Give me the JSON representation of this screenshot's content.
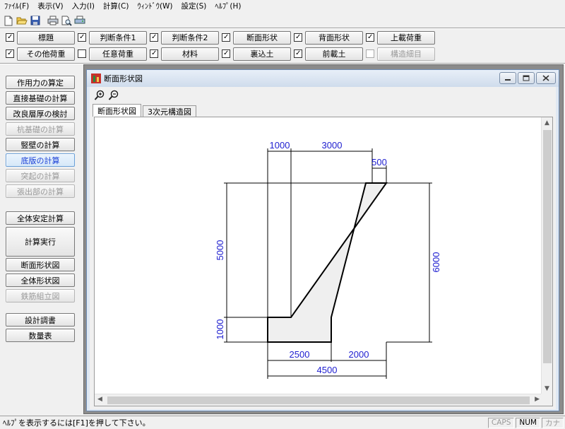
{
  "menu": [
    "ﾌｧｲﾙ(F)",
    "表示(V)",
    "入力(I)",
    "計算(C)",
    "ｳｨﾝﾄﾞｳ(W)",
    "設定(S)",
    "ﾍﾙﾌﾟ(H)"
  ],
  "toolbar_icons": [
    "new-file-icon",
    "open-folder-icon",
    "save-icon",
    "print-icon",
    "print-preview-icon",
    "printer-setup-icon"
  ],
  "check_row1": [
    {
      "label": "標題",
      "checked": true
    },
    {
      "label": "判断条件1",
      "checked": true
    },
    {
      "label": "判断条件2",
      "checked": true
    },
    {
      "label": "断面形状",
      "checked": true
    },
    {
      "label": "背面形状",
      "checked": true
    },
    {
      "label": "上載荷重",
      "checked": true
    }
  ],
  "check_row2": [
    {
      "label": "その他荷重",
      "checked": true
    },
    {
      "label": "任意荷重",
      "checked": false
    },
    {
      "label": "材料",
      "checked": true
    },
    {
      "label": "裏込土",
      "checked": true
    },
    {
      "label": "前載土",
      "checked": true
    },
    {
      "label": "構造細目",
      "checked": false,
      "disabled": true
    }
  ],
  "left_buttons_group1": [
    {
      "label": "作用力の算定",
      "state": "normal"
    },
    {
      "label": "直接基礎の計算",
      "state": "normal"
    },
    {
      "label": "改良層厚の検討",
      "state": "normal"
    },
    {
      "label": "杭基礎の計算",
      "state": "disabled"
    },
    {
      "label": "竪壁の計算",
      "state": "normal"
    },
    {
      "label": "底版の計算",
      "state": "active"
    },
    {
      "label": "突起の計算",
      "state": "disabled"
    },
    {
      "label": "張出部の計算",
      "state": "disabled"
    }
  ],
  "left_buttons_group2": [
    {
      "label": "全体安定計算",
      "state": "normal"
    },
    {
      "label": "計算実行",
      "state": "normal"
    },
    {
      "label": "断面形状図",
      "state": "normal"
    },
    {
      "label": "全体形状図",
      "state": "normal"
    },
    {
      "label": "鉄筋組立図",
      "state": "disabled"
    }
  ],
  "left_buttons_group3": [
    {
      "label": "設計調書",
      "state": "normal"
    },
    {
      "label": "数量表",
      "state": "normal"
    }
  ],
  "child_window": {
    "title": "断面形状図",
    "tabs": [
      "断面形状図",
      "3次元構造図"
    ],
    "active_tab": 0
  },
  "drawing": {
    "dims": {
      "top_left": "1000",
      "top_right": "3000",
      "top_tip": "500",
      "left_upper": "5000",
      "left_lower": "1000",
      "right_total": "6000",
      "bottom_left": "2500",
      "bottom_right": "2000",
      "bottom_total": "4500"
    },
    "dim_color": "#2020d0"
  },
  "status": {
    "message": "ﾍﾙﾌﾟを表示するには[F1]を押して下さい。",
    "indicators": [
      {
        "label": "CAPS",
        "on": false
      },
      {
        "label": "NUM",
        "on": true
      },
      {
        "label": "カナ",
        "on": false
      }
    ]
  }
}
